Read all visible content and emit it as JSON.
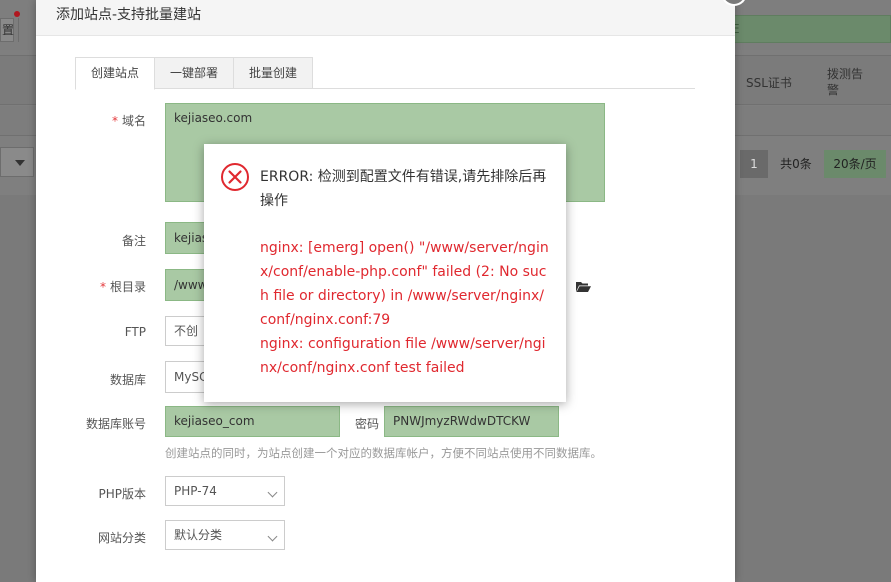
{
  "background": {
    "toolbar_fragment": "置",
    "green_strip_fragment": "E",
    "columns": {
      "ssl": "SSL证书",
      "probe": "拨测告警"
    },
    "pager": {
      "page": "1",
      "total": "共0条",
      "per_page": "20条/页"
    }
  },
  "modal": {
    "title": "添加站点-支持批量建站",
    "tabs": [
      {
        "label": "创建站点"
      },
      {
        "label": "一键部署"
      },
      {
        "label": "批量创建"
      }
    ],
    "form": {
      "domain_label": "域名",
      "domain_value": "kejiaseo.com",
      "remark_label": "备注",
      "remark_value": "kejias",
      "root_label": "根目录",
      "root_value": "/www",
      "ftp_label": "FTP",
      "ftp_value": "不创",
      "db_label": "数据库",
      "db_value": "MySC",
      "db_account_label": "数据库账号",
      "db_account_value": "kejiaseo_com",
      "password_label": "密码",
      "password_value": "PNWJmyzRWdwDTCKW",
      "db_hint": "创建站点的同时，为站点创建一个对应的数据库帐户，方便不同站点使用不同数据库。",
      "php_label": "PHP版本",
      "php_value": "PHP-74",
      "category_label": "网站分类",
      "category_value": "默认分类"
    }
  },
  "error_dialog": {
    "title": "ERROR: 检测到配置文件有错误,请先排除后再操作",
    "line1": "nginx: [emerg] open() \"/www/server/nginx/conf/enable-php.conf\" failed (2: No such file or directory) in /www/server/nginx/conf/nginx.conf:79",
    "line2": "nginx: configuration file /www/server/nginx/conf/nginx.conf test failed",
    "accent_color": "#e0282f"
  }
}
